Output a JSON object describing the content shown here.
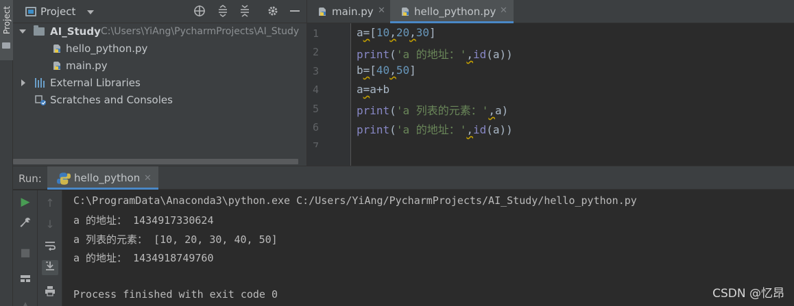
{
  "sidebar_strip": {
    "project_tab_label": "Project"
  },
  "project_panel": {
    "title": "Project",
    "tree": [
      {
        "label": "AI_Study",
        "path": "C:\\Users\\YiAng\\PycharmProjects\\AI_Study"
      },
      {
        "label": "hello_python.py"
      },
      {
        "label": "main.py"
      },
      {
        "label": "External Libraries"
      },
      {
        "label": "Scratches and Consoles"
      }
    ]
  },
  "editor": {
    "tabs": [
      {
        "label": "main.py"
      },
      {
        "label": "hello_python.py"
      }
    ],
    "line_numbers": [
      "1",
      "2",
      "3",
      "4",
      "5",
      "6",
      "7"
    ],
    "code": [
      "a=[10,20,30]",
      "print('a 的地址：',id(a))",
      "b=[40,50]",
      "a=a+b",
      "print('a 列表的元素：',a)",
      "print('a 的地址：',id(a))"
    ]
  },
  "run_panel": {
    "label": "Run:",
    "tab_label": "hello_python",
    "output": [
      "C:\\ProgramData\\Anaconda3\\python.exe C:/Users/YiAng/PycharmProjects/AI_Study/hello_python.py",
      "a 的地址： 1434917330624",
      "a 列表的元素： [10, 20, 30, 40, 50]",
      "a 的地址： 1434918749760",
      "",
      "Process finished with exit code 0"
    ]
  },
  "watermark": "CSDN @忆昂",
  "colors": {
    "panel_bg": "#3c3f41",
    "editor_bg": "#2b2b2b",
    "accent_blue": "#4a88c7",
    "run_green": "#499c54",
    "builtin": "#8888c6",
    "string": "#6a8759",
    "number": "#6897bb"
  }
}
